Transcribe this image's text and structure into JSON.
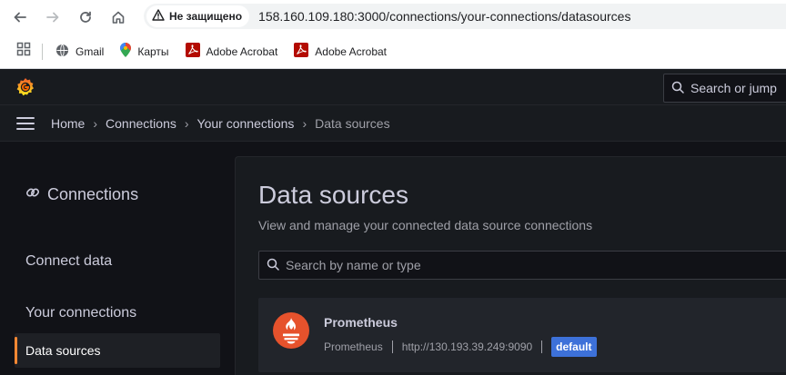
{
  "browser": {
    "security_label": "Не защищено",
    "url": "158.160.109.180:3000/connections/your-connections/datasources",
    "bookmarks": [
      {
        "label": "Gmail",
        "icon": "globe-icon"
      },
      {
        "label": "Карты",
        "icon": "maps-pin-icon"
      },
      {
        "label": "Adobe Acrobat",
        "icon": "acrobat-icon"
      },
      {
        "label": "Adobe Acrobat",
        "icon": "acrobat-icon"
      }
    ]
  },
  "header": {
    "search_placeholder": "Search or jump"
  },
  "breadcrumb": [
    "Home",
    "Connections",
    "Your connections",
    "Data sources"
  ],
  "sidebar": {
    "title": "Connections",
    "items": [
      {
        "label": "Connect data"
      },
      {
        "label": "Your connections"
      },
      {
        "label": "Data sources",
        "active": true
      }
    ]
  },
  "main": {
    "title": "Data sources",
    "subtitle": "View and manage your connected data source connections",
    "search_placeholder": "Search by name or type",
    "datasources": [
      {
        "name": "Prometheus",
        "type": "Prometheus",
        "url": "http://130.193.39.249:9090",
        "badge": "default",
        "icon": "prometheus-icon"
      }
    ]
  },
  "colors": {
    "accent": "#ff8833",
    "badge": "#3d71d9",
    "prometheus": "#e6522c"
  }
}
